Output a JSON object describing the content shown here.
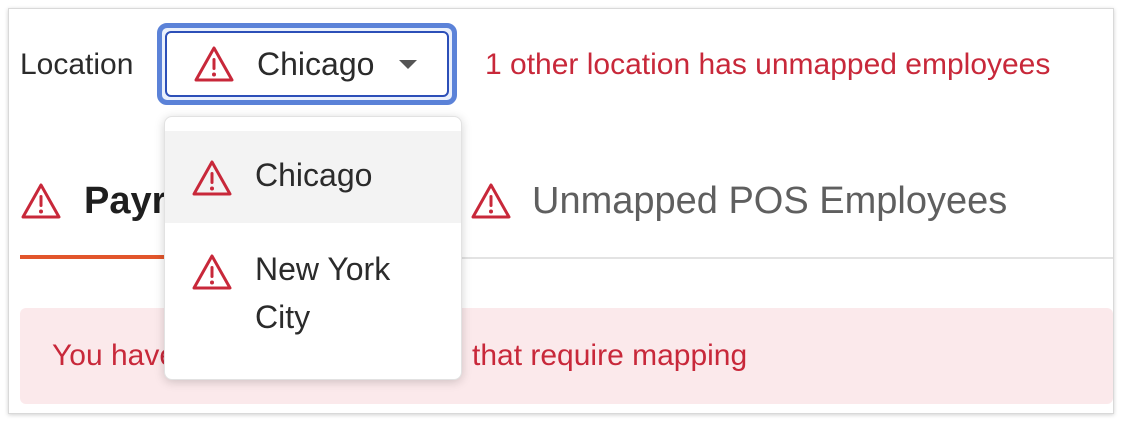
{
  "location": {
    "label": "Location",
    "selected": "Chicago",
    "warning": "1 other location has unmapped employees",
    "options": [
      {
        "label": "Chicago"
      },
      {
        "label": "New York City"
      }
    ]
  },
  "tabs": [
    {
      "label": "Payroll Employees",
      "visible_label": "Payr",
      "active": true
    },
    {
      "label": "Unmapped POS Employees",
      "active": false
    }
  ],
  "banner": {
    "text_left": "You have",
    "text_right": "that require mapping"
  },
  "icons": {
    "warning": "warning-triangle-icon",
    "dropdown_caret": "caret-down-icon"
  },
  "colors": {
    "warning_red": "#c8283a",
    "focus_blue": "#2c4fb8",
    "active_tab": "#e2552b",
    "banner_bg": "#fbe9eb"
  }
}
